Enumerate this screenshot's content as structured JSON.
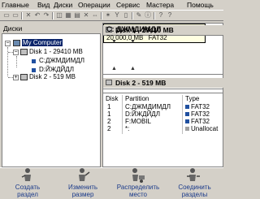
{
  "menu": [
    "Главные",
    "Вид",
    "Диски",
    "Операции",
    "Сервис",
    "Мастера",
    "Помощь"
  ],
  "left_panel": {
    "title": "Диски",
    "tree": {
      "root": "My Computer",
      "disk1": "Disk 1 - 29410 MB",
      "disk1_items": [
        "C:ДЖМДИМДЛ",
        "D:ЙЖДЙДЛ"
      ],
      "disk2": "Disk 2 - 519 MB"
    }
  },
  "right_panel": {
    "disk1_header": "Disk 1 - 29410 MB",
    "partition": {
      "label": "C: ДЖМДИМДЛ",
      "size": "20 000,0 MB",
      "fs": "FAT32"
    },
    "disk2_header": "Disk 2 - 519 MB",
    "table": {
      "headers": [
        "Disk",
        "Partition",
        "Type"
      ],
      "rows": [
        {
          "disk": "1",
          "partition": "C:ДЖМДИМДЛ",
          "type": "FAT32",
          "color": "#2050a0"
        },
        {
          "disk": "1",
          "partition": "D:ЙЖДЙДЛ",
          "type": "FAT32",
          "color": "#2050a0"
        },
        {
          "disk": "2",
          "partition": "F:MOBIL",
          "type": "FAT32",
          "color": "#2050a0"
        },
        {
          "disk": "2",
          "partition": "*:",
          "type": "Unallocat",
          "color": "#a0a0a0"
        }
      ]
    }
  },
  "actions": [
    {
      "line1": "Создать",
      "line2": "раздел"
    },
    {
      "line1": "Изменить",
      "line2": "размер"
    },
    {
      "line1": "Распределить",
      "line2": "место"
    },
    {
      "line1": "Соединить",
      "line2": "разделы"
    }
  ],
  "colors": {
    "selection": "#0a246a",
    "partition_highlight": "#ffffe1",
    "link_text": "#1a3a8a"
  }
}
